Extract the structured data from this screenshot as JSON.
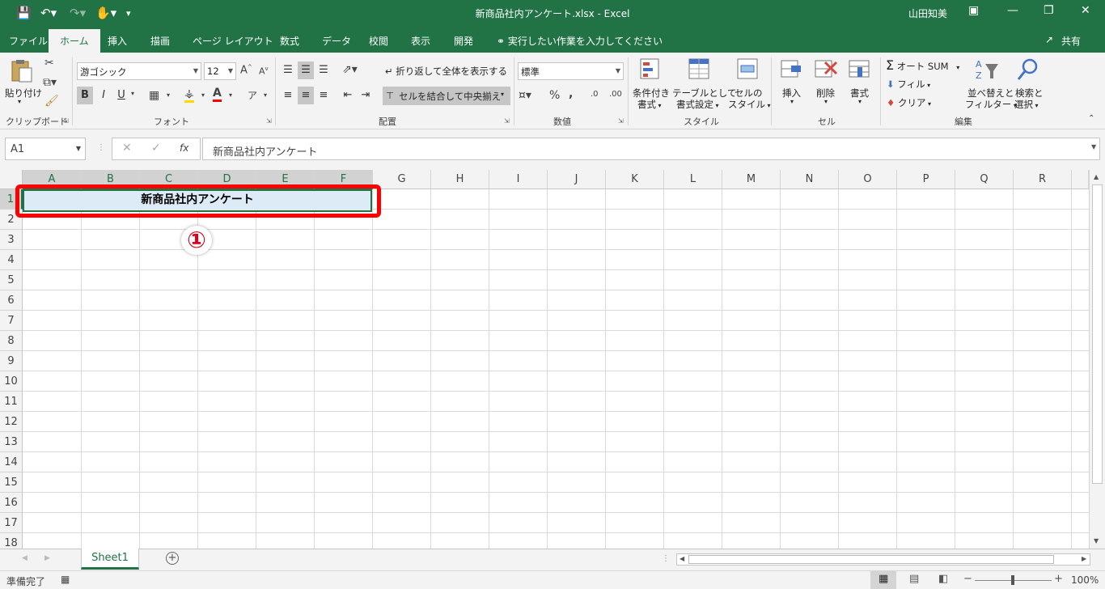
{
  "titlebar": {
    "title": "新商品社内アンケート.xlsx  -  Excel",
    "user": "山田知美"
  },
  "tabs": [
    "ファイル",
    "ホーム",
    "挿入",
    "描画",
    "ページ レイアウト",
    "数式",
    "データ",
    "校閲",
    "表示",
    "開発"
  ],
  "active_tab": "ホーム",
  "tell_me": "実行したい作業を入力してください",
  "share": "共有",
  "ribbon": {
    "clipboard": {
      "paste": "貼り付け",
      "label": "クリップボード"
    },
    "font": {
      "name": "游ゴシック",
      "size": "12",
      "label": "フォント"
    },
    "alignment": {
      "wrap": "折り返して全体を表示する",
      "merge": "セルを結合して中央揃え",
      "label": "配置"
    },
    "number": {
      "format": "標準",
      "label": "数値"
    },
    "styles": {
      "cond1": "条件付き",
      "cond2": "書式",
      "table1": "テーブルとして",
      "table2": "書式設定",
      "cell1": "セルの",
      "cell2": "スタイル",
      "label": "スタイル"
    },
    "cells": {
      "insert": "挿入",
      "delete": "削除",
      "format": "書式",
      "label": "セル"
    },
    "editing": {
      "autosum": "オート SUM",
      "fill": "フィル",
      "clear": "クリア",
      "sort1": "並べ替えと",
      "sort2": "フィルター",
      "find1": "検索と",
      "find2": "選択",
      "label": "編集"
    }
  },
  "formula_bar": {
    "name_box": "A1",
    "content": "新商品社内アンケート"
  },
  "columns": [
    "A",
    "B",
    "C",
    "D",
    "E",
    "F",
    "G",
    "H",
    "I",
    "J",
    "K",
    "L",
    "M",
    "N",
    "O",
    "P",
    "Q",
    "R"
  ],
  "rows": [
    "1",
    "2",
    "3",
    "4",
    "5",
    "6",
    "7",
    "8",
    "9",
    "10",
    "11",
    "12",
    "13",
    "14",
    "15",
    "16",
    "17",
    "18"
  ],
  "cell_a1": "新商品社内アンケート",
  "marker": "①",
  "sheet_tab": "Sheet1",
  "status": {
    "ready": "準備完了",
    "zoom": "100%"
  },
  "colors": {
    "excel_green": "#217346",
    "highlight_red": "#ff0000",
    "merged_fill": "#ddebf7"
  }
}
